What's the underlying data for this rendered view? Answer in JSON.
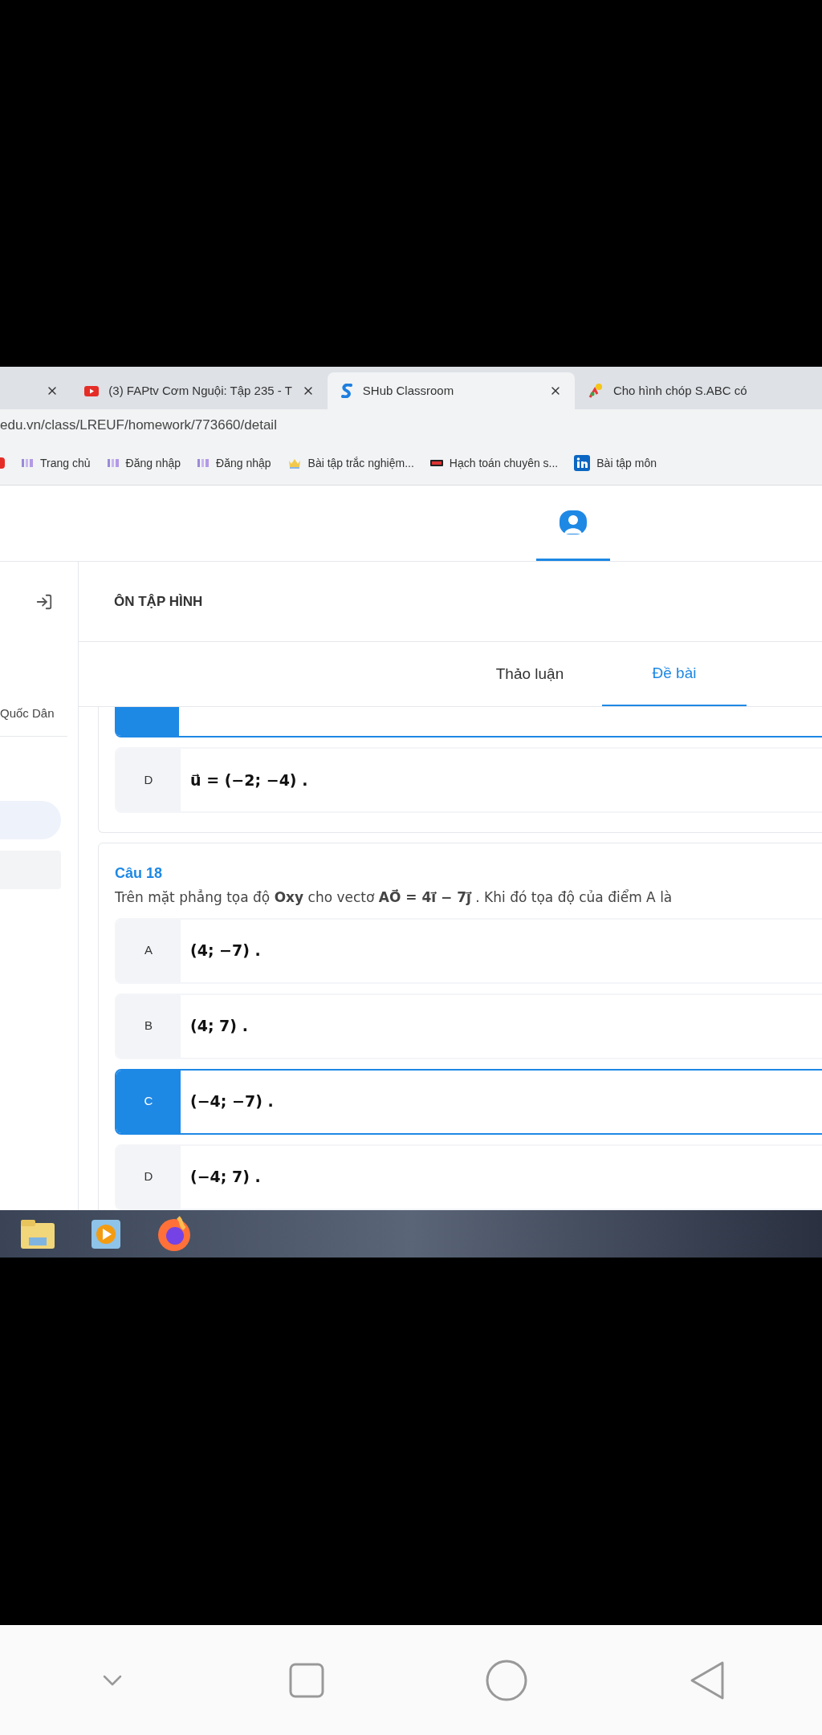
{
  "browser": {
    "tabs": [
      {
        "kind": "blank",
        "selected": false
      },
      {
        "kind": "video",
        "title": "(3) FAPtv Cơm Nguội: Tập 235 - T",
        "selected": false
      },
      {
        "kind": "swirl",
        "title": "SHub Classroom",
        "selected": true
      },
      {
        "kind": "figure",
        "title": "Cho hình chóp S.ABC có",
        "selected": false
      }
    ],
    "address": "edu.vn/class/LREUF/homework/773660/detail",
    "bookmarks": [
      {
        "kind": "red"
      },
      {
        "kind": "hs",
        "label": "Trang chủ"
      },
      {
        "kind": "hs",
        "label": "Đăng nhập"
      },
      {
        "kind": "hs",
        "label": "Đăng nhập"
      },
      {
        "kind": "crown",
        "label": "Bài tập trắc nghiệm..."
      },
      {
        "kind": "mini",
        "label": "Hạch toán chuyên s..."
      },
      {
        "kind": "linkedin",
        "label": "Bài tập môn"
      }
    ]
  },
  "sidebar": {
    "name": "Quốc Dân",
    "items": [
      {
        "kind": "pill"
      },
      {
        "kind": "block"
      }
    ]
  },
  "assignment": {
    "title": "ÔN TẬP HÌNH",
    "tabs": [
      {
        "label": "Thảo luận",
        "selected": false
      },
      {
        "label": "Đề bài",
        "selected": true
      }
    ]
  },
  "questions": [
    {
      "options": [
        {
          "selected": true
        },
        {
          "letter": "D",
          "answer": "u⃗ = (−2; −4) .",
          "selected": false
        }
      ]
    },
    {
      "title": "Câu 18",
      "text": "Trên mặt phẳng tọa độ **Oxy** cho vectơ **AO⃗ = 4i⃗ − 7j⃗** . Khi đó tọa độ của điểm A là",
      "options": [
        {
          "letter": "A",
          "answer": "(4; −7) .",
          "selected": false
        },
        {
          "letter": "B",
          "answer": "(4; 7) .",
          "selected": false
        },
        {
          "letter": "C",
          "answer": "(−4; −7) .",
          "selected": true
        },
        {
          "letter": "D",
          "answer": "(−4; 7) .",
          "selected": false
        }
      ]
    }
  ]
}
